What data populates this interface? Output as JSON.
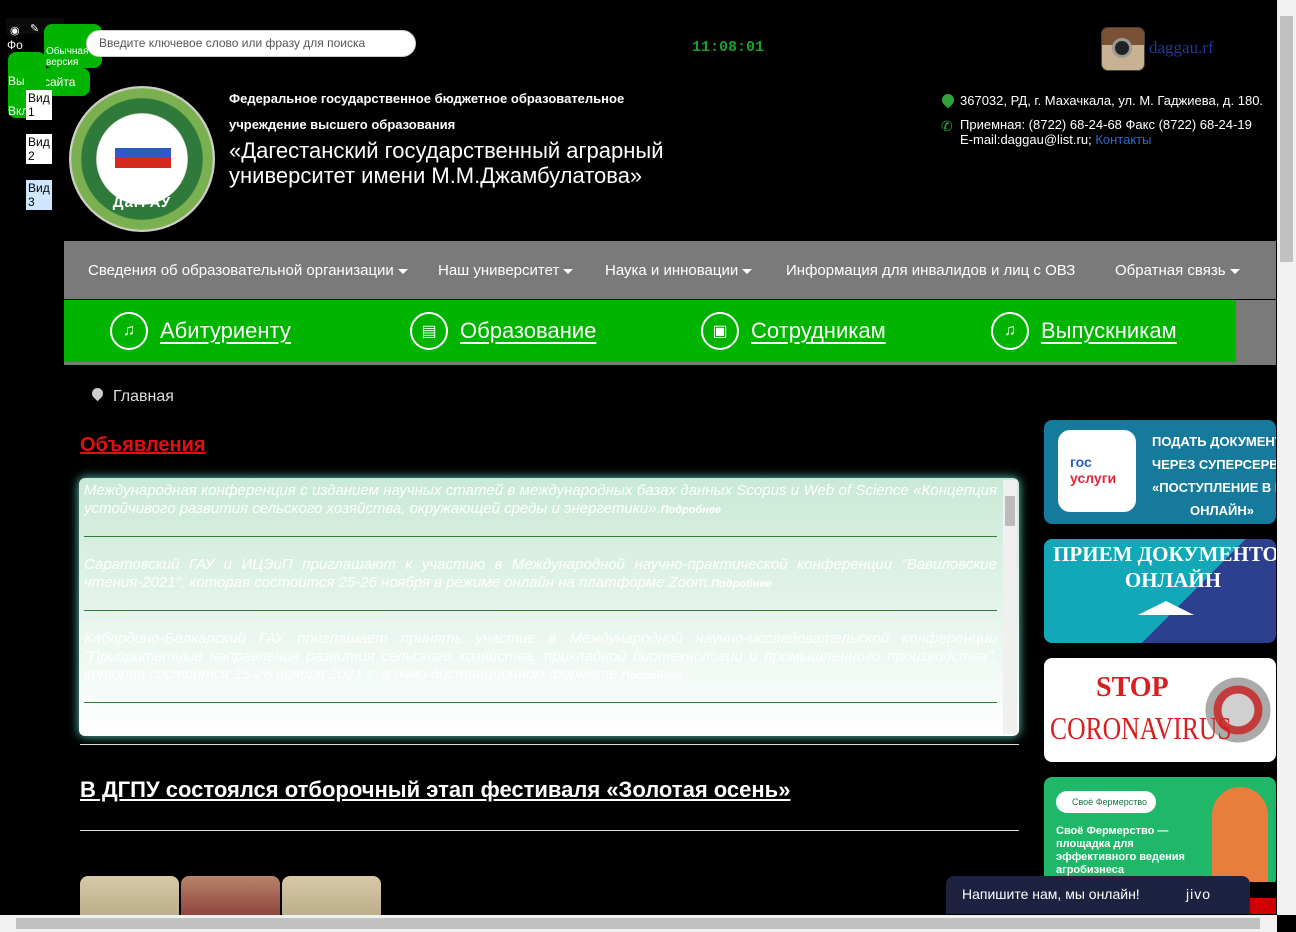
{
  "accessibility": {
    "photo_label": "Фо",
    "normal_label": "Обычная версия",
    "site_label": "сайта",
    "off_label": "Вы",
    "on_label": "Вкл",
    "view1": "Вид 1",
    "view2": "Вид 2",
    "view3": "Вид 3"
  },
  "search": {
    "placeholder": "Введите ключевое слово или фразу для поиска"
  },
  "clock": "11:08:01",
  "social": {
    "link_text": "daggau.rf"
  },
  "header": {
    "line1": "Федеральное государственное бюджетное образовательное",
    "line2": "учреждение высшего образования",
    "name": "«Дагестанский государственный аграрный университет имени М.М.Джамбулатова»",
    "logo_text": "ДагГАУ",
    "address": "367032, РД, г. Махачкала, ул. М. Гаджиева, д. 180.",
    "phones": "Приемная: (8722) 68-24-68 Факс (8722) 68-24-19",
    "email": "E-mail:daggau@list.ru;",
    "contacts_link": "Контакты"
  },
  "nav": {
    "items": [
      {
        "label": "Сведения об образовательной организации",
        "dropdown": true
      },
      {
        "label": "Наш университет",
        "dropdown": true
      },
      {
        "label": "Наука и инновации",
        "dropdown": true
      },
      {
        "label": "Информация для инвалидов и лиц с ОВЗ",
        "dropdown": false
      },
      {
        "label": "Обратная связь",
        "dropdown": true
      }
    ]
  },
  "quick_links": [
    {
      "label": "Абитуриенту",
      "icon": "bell-icon"
    },
    {
      "label": "Образование",
      "icon": "book-icon"
    },
    {
      "label": "Сотрудникам",
      "icon": "briefcase-icon"
    },
    {
      "label": "Выпускникам",
      "icon": "bell-icon"
    }
  ],
  "breadcrumb": "Главная",
  "announcements": {
    "title": "Объявления",
    "items": [
      {
        "text": "Международная конференция с изданием научных статей в международных базах данных Scopus и Web of Science «Концепция устойчивого развития сельского хозяйства, окружающей среды и энергетики».",
        "more": "Подробнее"
      },
      {
        "text": "Саратовский ГАУ и ИЦЭиП приглашают к участию в Международной научно-практической конференции \"Вавиловские чтения-2021\", которая состоится 25-26 ноября в режиме онлайн на платформе Zoom.",
        "more": "Подробнее"
      },
      {
        "text": "Кабардино-Балкарский ГАУ приглашает принять участие в Международной научно-исследовательской конференции \"Приоритетные направления развития сельского хозяйства, прикладной биотехнологии и промышленного производства\", которая состоится 25-26 ноября 2021 г. в очно-дистанционном формате.",
        "more": "Подробнее"
      }
    ]
  },
  "news": {
    "title": "В ДГПУ состоялся отборочный этап фестиваля «Золотая осень»"
  },
  "banners": {
    "gosuslugi": {
      "logo_top": "гос",
      "logo_bottom": "услуги",
      "lines": [
        "ПОДАТЬ ДОКУМЕНТЫ",
        "ЧЕРЕЗ СУПЕРСЕРВИС",
        "«ПОСТУПЛЕНИЕ В ВУЗ",
        "ОНЛАЙН»"
      ]
    },
    "online": {
      "lines": [
        "ПРИЕМ ДОКУМЕНТОВ",
        "ОНЛАЙН"
      ]
    },
    "corona": {
      "stop": "STOP",
      "word": "CORONAVIRUS"
    },
    "farm": {
      "chip": "Своё Фермерство",
      "text": "Своё Фермерство — площадка для эффективного ведения агробизнеса"
    }
  },
  "chat": {
    "text": "Напишите нам, мы онлайн!",
    "brand": "jivo"
  },
  "colors": {
    "accent_green": "#00b400",
    "nav_gray": "#7a7a7a",
    "ads_red": "#e01010"
  }
}
